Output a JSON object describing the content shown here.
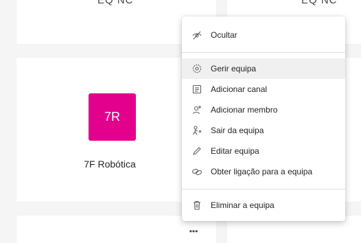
{
  "cards": {
    "top_left_text": "EQ NC",
    "top_right_text": "EQ NC"
  },
  "team": {
    "initials": "7R",
    "name": "7F Robótica",
    "avatar_color": "#e3008c"
  },
  "more_button": {
    "label": "•••"
  },
  "menu": {
    "items": [
      {
        "label": "Ocultar",
        "icon": "hide-icon"
      },
      {
        "label": "Gerir equipa",
        "icon": "gear-icon",
        "selected": true
      },
      {
        "label": "Adicionar canal",
        "icon": "add-channel-icon"
      },
      {
        "label": "Adicionar membro",
        "icon": "add-member-icon"
      },
      {
        "label": "Sair da equipa",
        "icon": "leave-team-icon"
      },
      {
        "label": "Editar equipa",
        "icon": "edit-icon"
      },
      {
        "label": "Obter ligação para a equipa",
        "icon": "link-icon"
      },
      {
        "label": "Eliminar a equipa",
        "icon": "trash-icon"
      }
    ]
  }
}
